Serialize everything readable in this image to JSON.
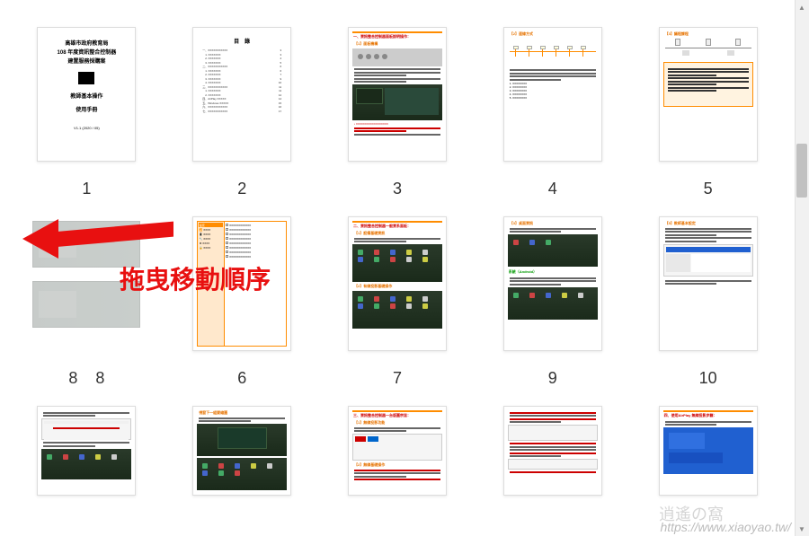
{
  "annotation": {
    "drag_label": "拖曳移動順序"
  },
  "watermark": {
    "logo": "逍遙の窩",
    "url": "https://www.xiaoyao.tw/"
  },
  "pages": {
    "row1": [
      {
        "num": "1",
        "title1": "高雄市政府教育局",
        "title2": "108 年度資訊整合控制器",
        "title3": "建置服務採購案",
        "op1": "教師基本操作",
        "op2": "使用手冊",
        "ver": "V1.1 (2020 / 05)"
      },
      {
        "num": "2",
        "title": "目　錄"
      },
      {
        "num": "3",
        "header": "一、資訊整合控制器面板說明操作：",
        "sub": "【1】面板機構"
      },
      {
        "num": "4",
        "header": "【2】連線方式"
      },
      {
        "num": "5",
        "header": "【3】議程課程"
      }
    ],
    "row2": [
      {
        "num_a": "8",
        "num_b": "8"
      },
      {
        "num": "6"
      },
      {
        "num": "7",
        "header": "二、資訊整合控制器一般資系面板：",
        "sub1": "【1】設備基礎資訊",
        "sub2": "【2】有線投影基礎操作"
      },
      {
        "num": "9",
        "header": "【3】桌面資訊",
        "sub": "系統（Android）"
      },
      {
        "num": "10",
        "header": "【5】教師基本設定"
      }
    ],
    "row3": [
      {
        "sub": "視窗下一組要頁面"
      },
      {
        "sub": "視窗下一組要縮圖"
      },
      {
        "header": "三、資訊整合控制器一台版圖宗旨：",
        "sub": "【1】無線投影功能",
        "sub2": "【2】無線基礎操作"
      },
      {},
      {
        "header": "四、使用AirPlay 無線投影步驟："
      }
    ]
  }
}
